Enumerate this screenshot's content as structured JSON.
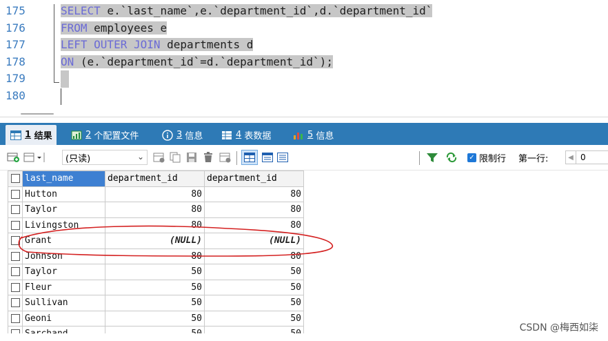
{
  "editor": {
    "line_numbers": [
      "175",
      "176",
      "177",
      "178",
      "179",
      "180"
    ],
    "lines": [
      {
        "kw": "SELECT",
        "rest": " e.`last_name`,e.`department_id`,d.`department_id`"
      },
      {
        "kw": "FROM",
        "rest": " employees e"
      },
      {
        "kw": "LEFT OUTER JOIN",
        "rest": " departments d"
      },
      {
        "kw": "ON",
        "rest": " (e.`department_id`=d.`department_id`);"
      }
    ]
  },
  "tabs": [
    {
      "num": "1",
      "label": "结果"
    },
    {
      "num": "2",
      "label": "个配置文件"
    },
    {
      "num": "3",
      "label": "信息"
    },
    {
      "num": "4",
      "label": "表数据"
    },
    {
      "num": "5",
      "label": "信息"
    }
  ],
  "toolbar": {
    "readonly_select": "(只读)",
    "limit_rows_label": "限制行",
    "first_row_label": "第一行:",
    "first_row_value": "0"
  },
  "grid": {
    "columns": [
      "last_name",
      "department_id",
      "department_id"
    ],
    "rows": [
      [
        "Hutton",
        "80",
        "80"
      ],
      [
        "Taylor",
        "80",
        "80"
      ],
      [
        "Livingston",
        "80",
        "80"
      ],
      [
        "Grant",
        "(NULL)",
        "(NULL)"
      ],
      [
        "Johnson",
        "80",
        "80"
      ],
      [
        "Taylor",
        "50",
        "50"
      ],
      [
        "Fleur",
        "50",
        "50"
      ],
      [
        "Sullivan",
        "50",
        "50"
      ],
      [
        "Geoni",
        "50",
        "50"
      ],
      [
        "Sarchand",
        "50",
        "50"
      ]
    ]
  },
  "watermark": "CSDN @梅西如柒",
  "colors": {
    "tab_bar": "#2e7ab6",
    "keyword": "#6b6bd6",
    "annotation": "#d42020",
    "selected_header": "#3e80d2"
  }
}
